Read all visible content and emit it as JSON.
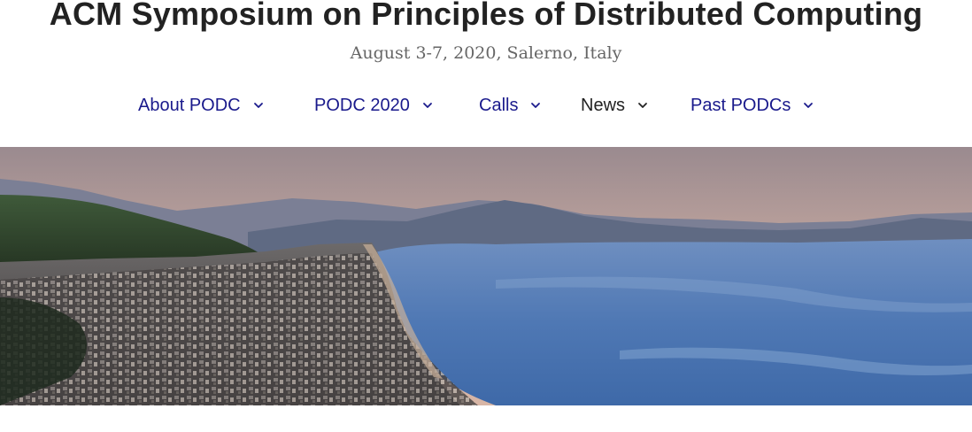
{
  "header": {
    "title": "ACM Symposium on Principles of Distributed Computing",
    "subtitle": "August 3-7, 2020, Salerno, Italy"
  },
  "nav": {
    "items": [
      {
        "label": "About PODC",
        "icon": "chevron-down-icon"
      },
      {
        "label": "PODC 2020",
        "icon": "chevron-down-icon"
      },
      {
        "label": "Calls",
        "icon": "chevron-down-icon"
      },
      {
        "label": "News",
        "icon": "chevron-down-icon"
      },
      {
        "label": "Past PODCs",
        "icon": "chevron-down-icon"
      }
    ],
    "link_color": "#1a1a8c",
    "active_color": "#222222"
  },
  "hero": {
    "subject": "panoramic photo of Salerno coastline"
  }
}
